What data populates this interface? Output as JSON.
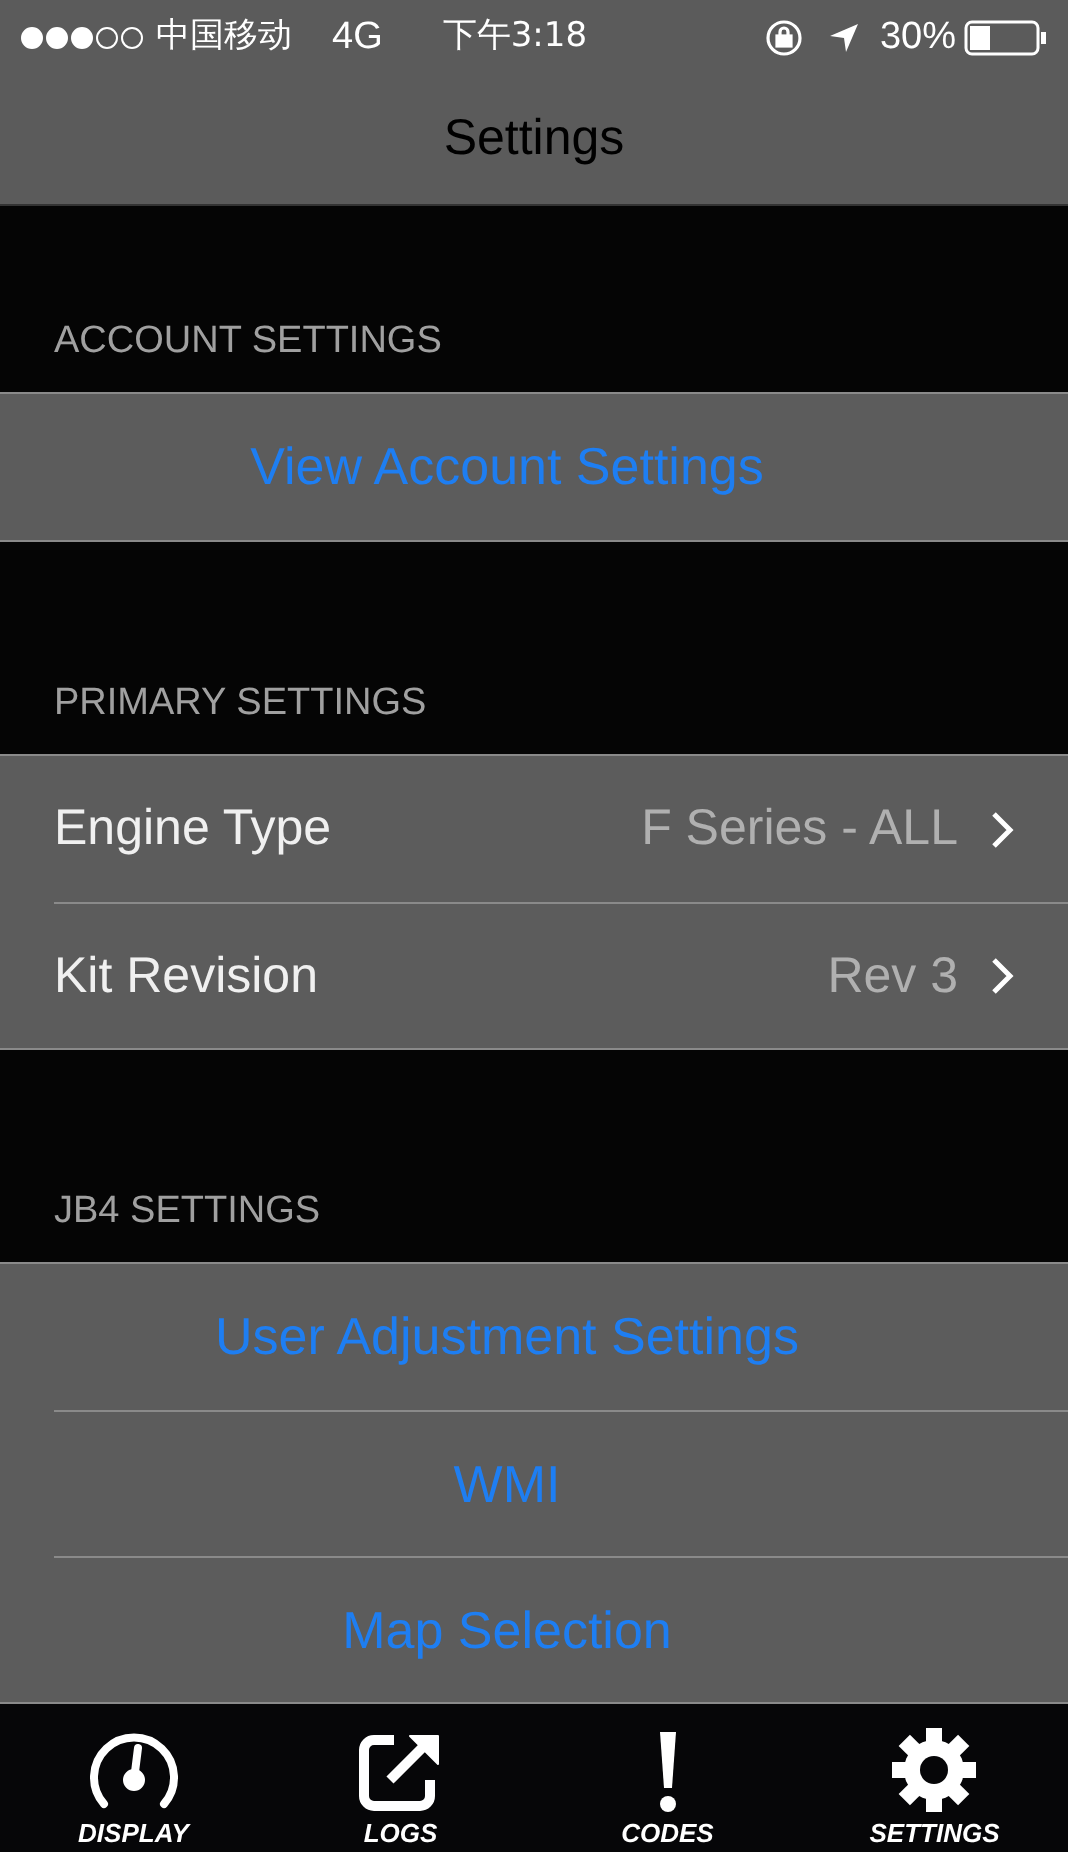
{
  "status_bar": {
    "carrier": "中国移动",
    "network": "4G",
    "time": "下午3:18",
    "battery": "30%"
  },
  "nav_bar": {
    "title": "Settings"
  },
  "sections": [
    {
      "header": "ACCOUNT SETTINGS",
      "rows": [
        {
          "kind": "action",
          "label": "View Account Settings"
        }
      ]
    },
    {
      "header": "PRIMARY SETTINGS",
      "rows": [
        {
          "kind": "detail",
          "label": "Engine Type",
          "value": "F Series - ALL"
        },
        {
          "kind": "detail",
          "label": "Kit Revision",
          "value": "Rev 3"
        }
      ]
    },
    {
      "header": "JB4 SETTINGS",
      "rows": [
        {
          "kind": "action",
          "label": "User Adjustment Settings"
        },
        {
          "kind": "action",
          "label": "WMI"
        },
        {
          "kind": "action",
          "label": "Map Selection"
        }
      ]
    }
  ],
  "tab_bar": [
    {
      "label": "DISPLAY"
    },
    {
      "label": "LOGS"
    },
    {
      "label": "CODES"
    },
    {
      "label": "SETTINGS"
    }
  ]
}
